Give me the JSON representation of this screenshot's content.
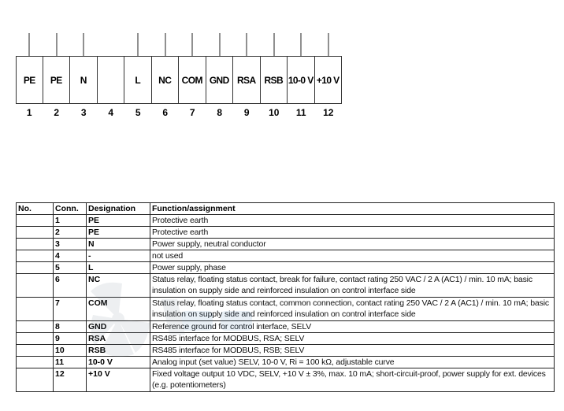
{
  "diagram": {
    "terminals": [
      {
        "label": "PE",
        "number": "1",
        "wired": true
      },
      {
        "label": "PE",
        "number": "2",
        "wired": true
      },
      {
        "label": "N",
        "number": "3",
        "wired": true
      },
      {
        "label": "",
        "number": "4",
        "wired": false
      },
      {
        "label": "L",
        "number": "5",
        "wired": true
      },
      {
        "label": "NC",
        "number": "6",
        "wired": true
      },
      {
        "label": "COM",
        "number": "7",
        "wired": true
      },
      {
        "label": "GND",
        "number": "8",
        "wired": true
      },
      {
        "label": "RSA",
        "number": "9",
        "wired": true
      },
      {
        "label": "RSB",
        "number": "10",
        "wired": true
      },
      {
        "label": "10-0 V",
        "number": "11",
        "wired": true
      },
      {
        "label": "+10 V",
        "number": "12",
        "wired": true
      }
    ]
  },
  "table": {
    "headers": [
      "No.",
      "Conn.",
      "Designation",
      "Function/assignment"
    ],
    "rows": [
      {
        "no": "",
        "conn": "1",
        "designation": "PE",
        "function": "Protective earth"
      },
      {
        "no": "",
        "conn": "2",
        "designation": "PE",
        "function": "Protective earth"
      },
      {
        "no": "",
        "conn": "3",
        "designation": "N",
        "function": "Power supply, neutral conductor"
      },
      {
        "no": "",
        "conn": "4",
        "designation": "-",
        "function": "not used"
      },
      {
        "no": "",
        "conn": "5",
        "designation": "L",
        "function": "Power supply, phase"
      },
      {
        "no": "",
        "conn": "6",
        "designation": "NC",
        "function": "Status relay, floating status contact, break for failure, contact rating 250 VAC / 2 A (AC1) / min. 10 mA; basic insulation on supply side and reinforced insulation on control interface side"
      },
      {
        "no": "",
        "conn": "7",
        "designation": "COM",
        "function": "Status relay, floating status contact, common connection, contact rating 250 VAC / 2 A (AC1) / min. 10 mA; basic insulation on supply side and reinforced insulation on control interface side"
      },
      {
        "no": "",
        "conn": "8",
        "designation": "GND",
        "function": "Reference ground for control interface, SELV"
      },
      {
        "no": "",
        "conn": "9",
        "designation": "RSA",
        "function": "RS485 interface for MODBUS, RSA; SELV"
      },
      {
        "no": "",
        "conn": "10",
        "designation": "RSB",
        "function": "RS485 interface for MODBUS, RSB; SELV"
      },
      {
        "no": "",
        "conn": "11",
        "designation": "10-0 V",
        "function": "Analog input (set value) SELV, 10-0 V, Ri = 100 kΩ, adjustable curve"
      },
      {
        "no": "",
        "conn": "12",
        "designation": "+10 V",
        "function": "Fixed voltage output 10 VDC, SELV, +10 V ± 3%, max. 10 mA; short-circuit-proof, power supply for ext. devices (e.g. potentiometers)"
      }
    ]
  },
  "watermark": {
    "icon": "fan-logo-watermark",
    "color": "#5a8fc0"
  }
}
